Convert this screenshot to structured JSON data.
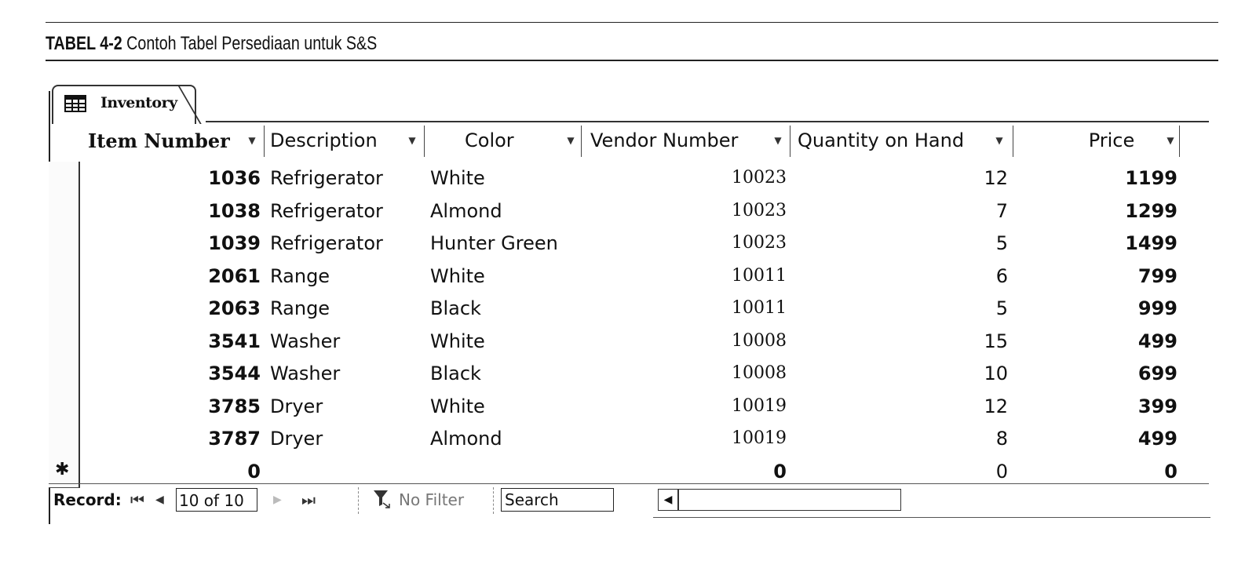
{
  "caption": {
    "label": "TABEL 4-2",
    "text": "Contoh Tabel Persediaan untuk S&S"
  },
  "tab": {
    "icon": "table-icon",
    "label": "Inventory"
  },
  "columns": [
    {
      "label": "Item Number",
      "icon": "dropdown-arrow-icon"
    },
    {
      "label": "Description",
      "icon": "dropdown-arrow-icon"
    },
    {
      "label": "Color",
      "icon": "dropdown-arrow-icon"
    },
    {
      "label": "Vendor Number",
      "icon": "dropdown-arrow-icon"
    },
    {
      "label": "Quantity on Hand",
      "icon": "dropdown-arrow-icon"
    },
    {
      "label": "Price",
      "icon": "dropdown-arrow-icon"
    }
  ],
  "rows": [
    {
      "item": "1036",
      "description": "Refrigerator",
      "color": "White",
      "vendor": "10023",
      "qty": "12",
      "price": "1199"
    },
    {
      "item": "1038",
      "description": "Refrigerator",
      "color": "Almond",
      "vendor": "10023",
      "qty": "7",
      "price": "1299"
    },
    {
      "item": "1039",
      "description": "Refrigerator",
      "color": "Hunter Green",
      "vendor": "10023",
      "qty": "5",
      "price": "1499"
    },
    {
      "item": "2061",
      "description": "Range",
      "color": "White",
      "vendor": "10011",
      "qty": "6",
      "price": "799"
    },
    {
      "item": "2063",
      "description": "Range",
      "color": "Black",
      "vendor": "10011",
      "qty": "5",
      "price": "999"
    },
    {
      "item": "3541",
      "description": "Washer",
      "color": "White",
      "vendor": "10008",
      "qty": "15",
      "price": "499"
    },
    {
      "item": "3544",
      "description": "Washer",
      "color": "Black",
      "vendor": "10008",
      "qty": "10",
      "price": "699"
    },
    {
      "item": "3785",
      "description": "Dryer",
      "color": "White",
      "vendor": "10019",
      "qty": "12",
      "price": "399"
    },
    {
      "item": "3787",
      "description": "Dryer",
      "color": "Almond",
      "vendor": "10019",
      "qty": "8",
      "price": "499"
    }
  ],
  "new_row": {
    "marker": "✱",
    "item": "0",
    "description": "",
    "color": "",
    "vendor": "0",
    "qty": "0",
    "price": "0"
  },
  "navigation": {
    "record_label": "Record:",
    "first_icon": "⏮",
    "prev_icon": "◀",
    "current": "10 of 10",
    "next_icon": "▶",
    "last_icon": "⏭",
    "filter_icon": "filter-icon",
    "filter_label": "No Filter",
    "search_placeholder": "Search",
    "scroll_left_icon": "◀"
  }
}
